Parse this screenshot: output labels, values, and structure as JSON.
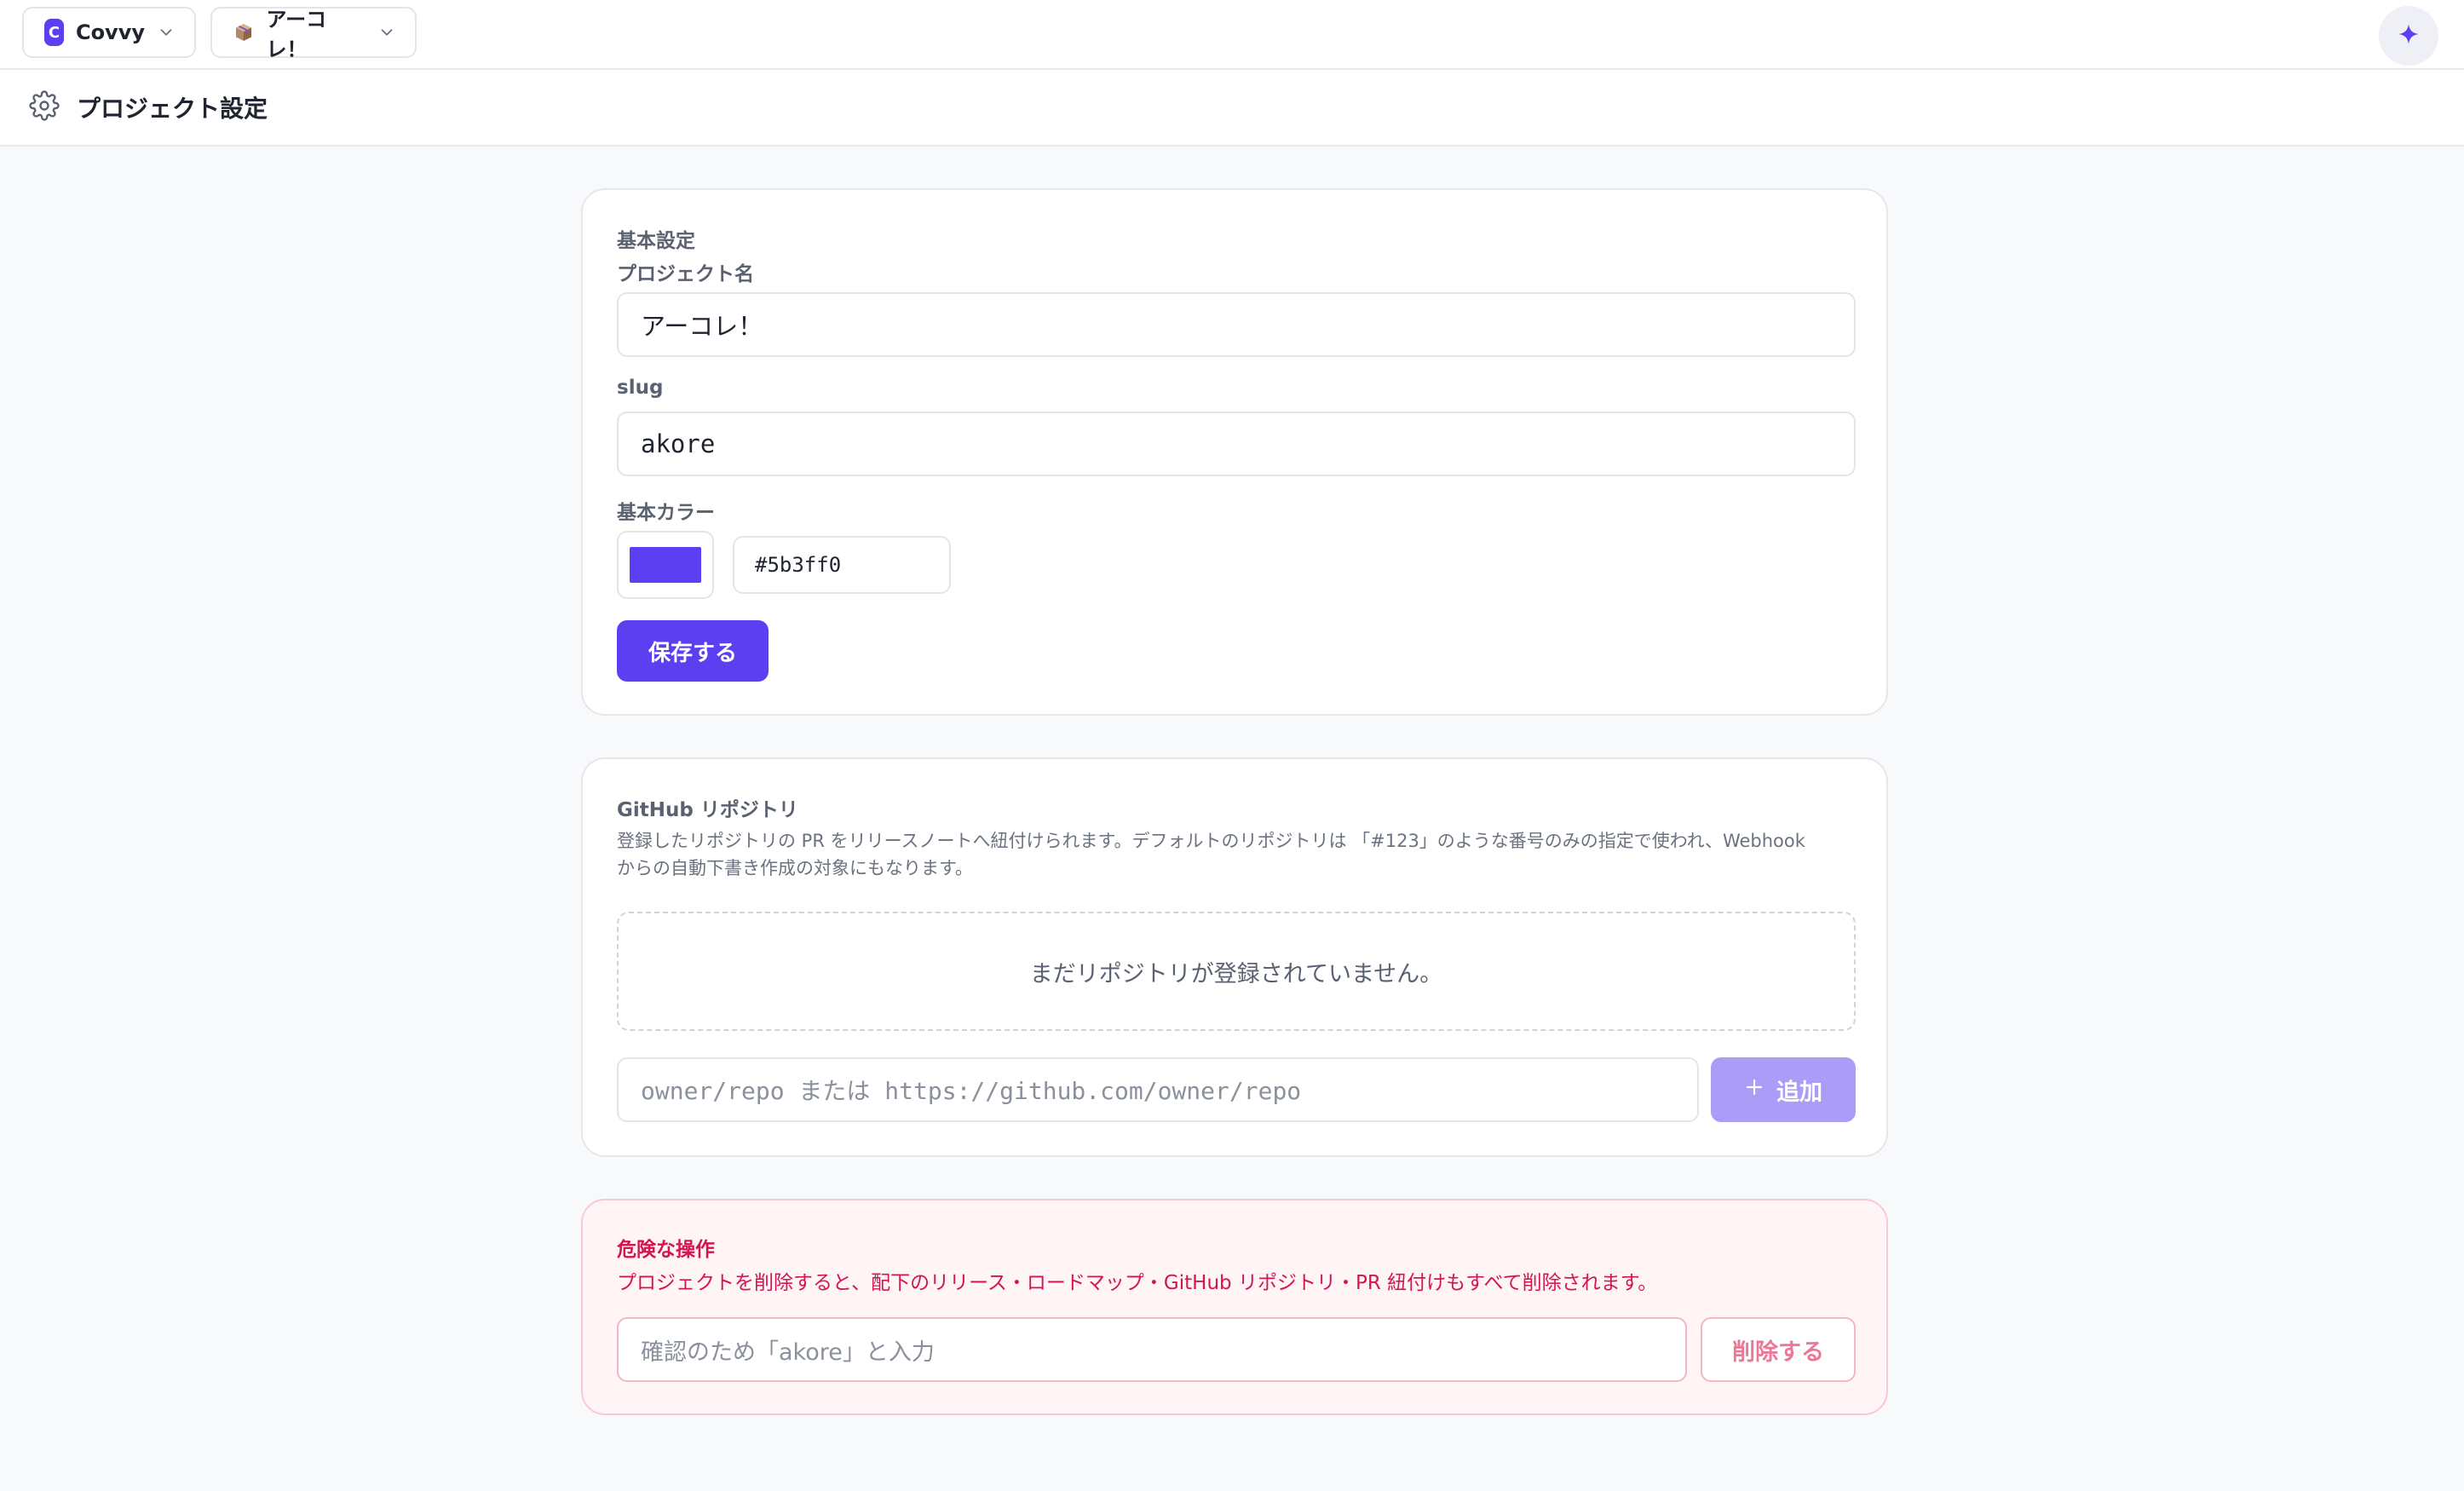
{
  "topbar": {
    "org": {
      "logo_letter": "C",
      "name": "Covvy",
      "icon": "chevron-down-icon"
    },
    "project": {
      "emoji": "📦",
      "name": "アーコレ！",
      "icon": "chevron-down-icon"
    },
    "ai_button_icon": "sparkle-icon"
  },
  "page": {
    "title": "プロジェクト設定",
    "icon": "gear-icon"
  },
  "basic": {
    "section_label": "基本設定",
    "name_label": "プロジェクト名",
    "name_value": "アーコレ！",
    "slug_label": "slug",
    "slug_value": "akore",
    "color_label": "基本カラー",
    "color_value": "#5b3ff0",
    "save_label": "保存する"
  },
  "github": {
    "section_label": "GitHub リポジトリ",
    "description_line1": "登録したリポジトリの PR をリリースノートへ紐付けられます。デフォルトのリポジトリは 「#123」のような番号のみの指定で使われ、Webhook",
    "description_line2": "からの自動下書き作成の対象にもなります。",
    "empty_text": "まだリポジトリが登録されていません。",
    "repo_placeholder": "owner/repo または https://github.com/owner/repo",
    "add_label": "追加"
  },
  "danger": {
    "title": "危険な操作",
    "description": "プロジェクトを削除すると、配下のリリース・ロードマップ・GitHub リポジトリ・PR 紐付けもすべて削除されます。",
    "confirm_placeholder": "確認のため「akore」と入力",
    "delete_label": "削除する"
  },
  "colors": {
    "accent": "#5b3ff0",
    "accent_disabled": "#ab9cf7",
    "danger": "#d31553"
  }
}
